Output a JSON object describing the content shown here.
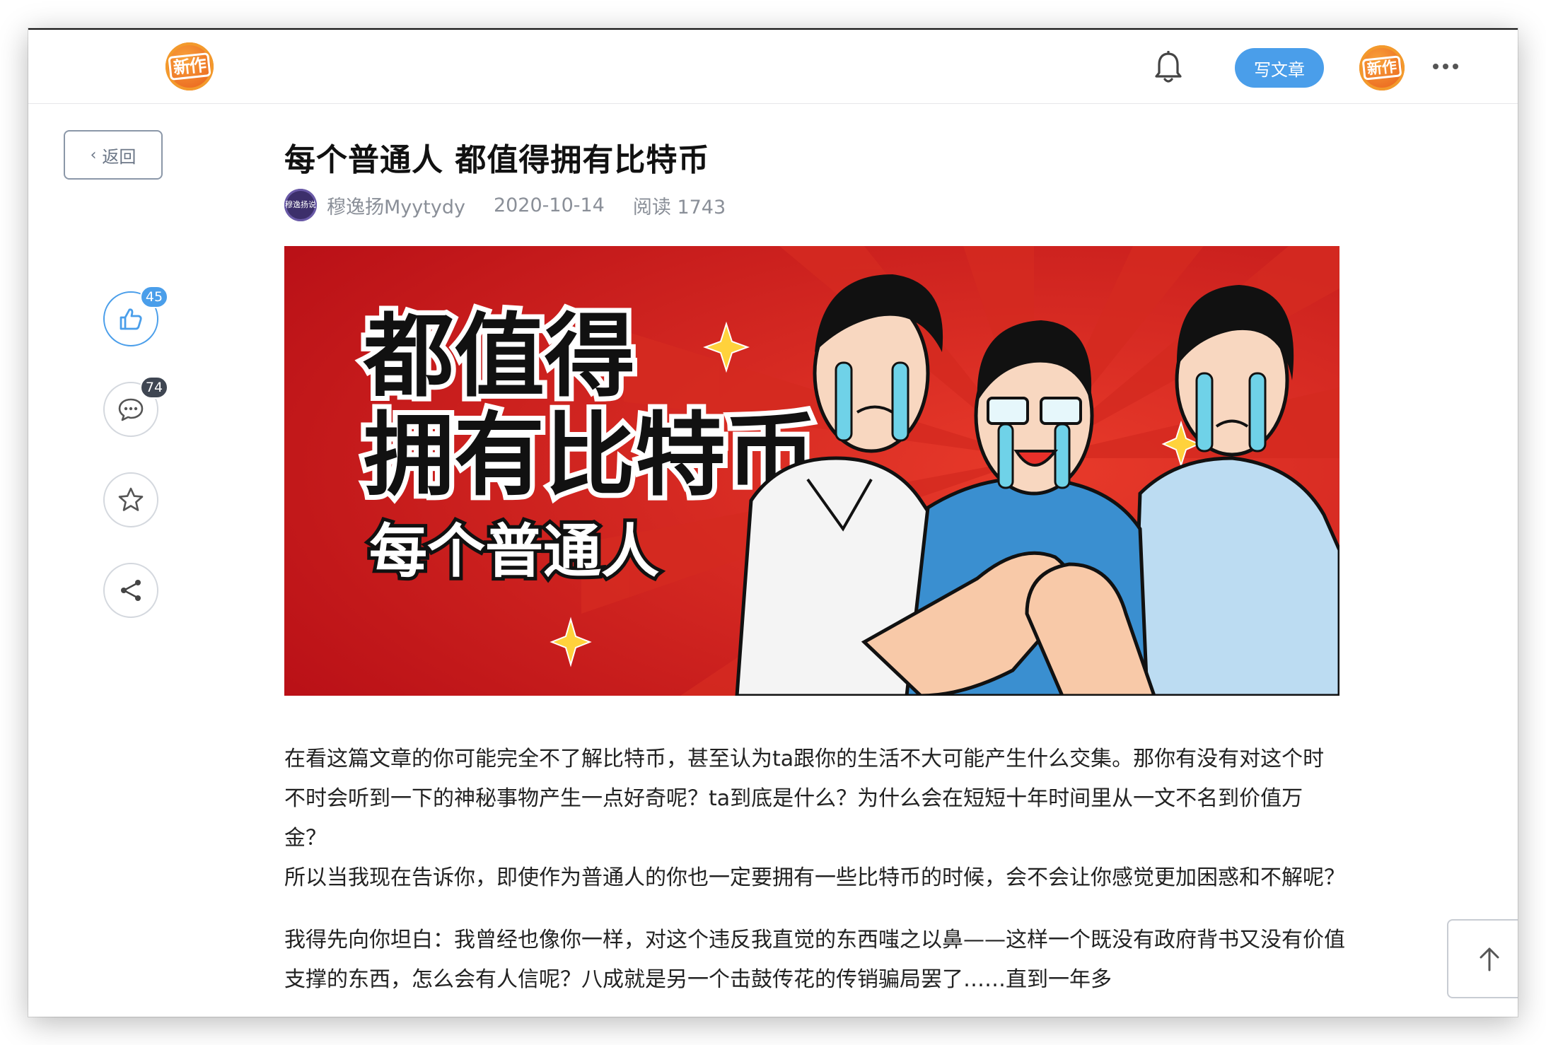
{
  "header": {
    "logo_text": "新作",
    "write_label": "写文章",
    "avatar_text": "新作"
  },
  "back": {
    "label": "返回"
  },
  "actions": {
    "like_count": "45",
    "comment_count": "74"
  },
  "article": {
    "title": "每个普通人 都值得拥有比特币",
    "author": "穆逸扬Myytydy",
    "author_avatar_text": "穆逸扬说",
    "date": "2020-10-14",
    "reads": "阅读 1743",
    "banner": {
      "line1": "都值得",
      "line2": "拥有比特币",
      "line3": "每个普通人"
    },
    "paragraphs": [
      "在看这篇文章的你可能完全不了解比特币，甚至认为ta跟你的生活不大可能产生什么交集。那你有没有对这个时不时会听到一下的神秘事物产生一点好奇呢？ta到底是什么？为什么会在短短十年时间里从一文不名到价值万金？",
      "所以当我现在告诉你，即使作为普通人的你也一定要拥有一些比特币的时候，会不会让你感觉更加困惑和不解呢？",
      "我得先向你坦白：我曾经也像你一样，对这个违反我直觉的东西嗤之以鼻——这样一个既没有政府背书又没有价值支撑的东西，怎么会有人信呢？八成就是另一个击鼓传花的传销骗局罢了……直到一年多"
    ]
  },
  "colors": {
    "accent": "#4a9eea",
    "banner_red": "#c8141b",
    "logo_orange": "#e8591a"
  },
  "icons": [
    "bell-icon",
    "more-icon",
    "chevron-left-icon",
    "thumbs-up-icon",
    "comment-icon",
    "star-icon",
    "share-icon",
    "arrow-up-icon"
  ]
}
